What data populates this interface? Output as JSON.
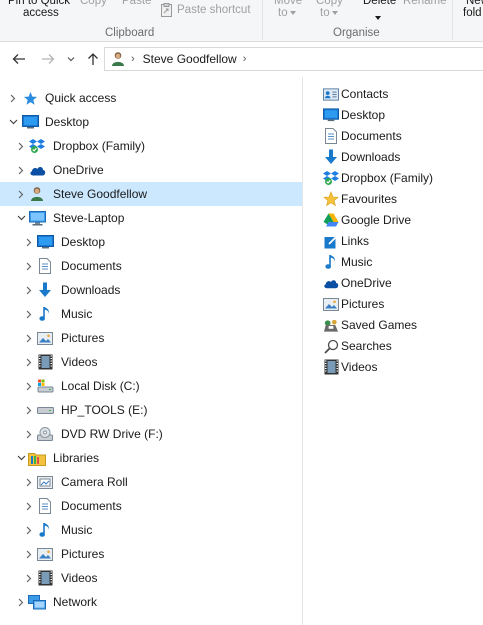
{
  "ribbon": {
    "pin_label_1": "Pin to Quick",
    "pin_label_2": "access",
    "copy_label": "Copy",
    "paste_label": "Paste",
    "paste_shortcut_label": "Paste shortcut",
    "clipboard_group": "Clipboard",
    "move_to_label_1": "Move",
    "move_to_label_2": "to",
    "copy_to_label_1": "Copy",
    "copy_to_label_2": "to",
    "delete_label": "Delete",
    "rename_label": "Rename",
    "organise_group": "Organise",
    "new_folder_label_1": "New",
    "new_folder_label_2": "fold"
  },
  "address": {
    "location": "Steve Goodfellow"
  },
  "tree": [
    {
      "label": "Quick access",
      "icon": "star-icon",
      "level": 0,
      "arrow": "right"
    },
    {
      "label": "Desktop",
      "icon": "desktop-icon",
      "level": 0,
      "arrow": "down"
    },
    {
      "label": "Dropbox (Family)",
      "icon": "dropbox-icon",
      "level": 1,
      "arrow": "right"
    },
    {
      "label": "OneDrive",
      "icon": "onedrive-icon",
      "level": 1,
      "arrow": "right"
    },
    {
      "label": "Steve Goodfellow",
      "icon": "user-icon",
      "level": 1,
      "arrow": "right",
      "selected": true
    },
    {
      "label": "Steve-Laptop",
      "icon": "computer-icon",
      "level": 1,
      "arrow": "down"
    },
    {
      "label": "Desktop",
      "icon": "desktop-icon",
      "level": 2,
      "arrow": "right"
    },
    {
      "label": "Documents",
      "icon": "documents-icon",
      "level": 2,
      "arrow": "right"
    },
    {
      "label": "Downloads",
      "icon": "downloads-icon",
      "level": 2,
      "arrow": "right"
    },
    {
      "label": "Music",
      "icon": "music-icon",
      "level": 2,
      "arrow": "right"
    },
    {
      "label": "Pictures",
      "icon": "pictures-icon",
      "level": 2,
      "arrow": "right"
    },
    {
      "label": "Videos",
      "icon": "videos-icon",
      "level": 2,
      "arrow": "right"
    },
    {
      "label": "Local Disk (C:)",
      "icon": "local-disk-icon",
      "level": 2,
      "arrow": "right"
    },
    {
      "label": "HP_TOOLS (E:)",
      "icon": "drive-icon",
      "level": 2,
      "arrow": "right"
    },
    {
      "label": "DVD RW Drive (F:)",
      "icon": "dvd-icon",
      "level": 2,
      "arrow": "right"
    },
    {
      "label": "Libraries",
      "icon": "libraries-icon",
      "level": 1,
      "arrow": "down"
    },
    {
      "label": "Camera Roll",
      "icon": "camera-roll-icon",
      "level": 2,
      "arrow": "right"
    },
    {
      "label": "Documents",
      "icon": "documents-icon",
      "level": 2,
      "arrow": "right"
    },
    {
      "label": "Music",
      "icon": "music-icon",
      "level": 2,
      "arrow": "right"
    },
    {
      "label": "Pictures",
      "icon": "pictures-icon",
      "level": 2,
      "arrow": "right"
    },
    {
      "label": "Videos",
      "icon": "videos-icon",
      "level": 2,
      "arrow": "right"
    },
    {
      "label": "Network",
      "icon": "network-icon",
      "level": 1,
      "arrow": "right"
    }
  ],
  "items": [
    {
      "label": "Contacts",
      "icon": "contacts-icon"
    },
    {
      "label": "Desktop",
      "icon": "desktop-icon"
    },
    {
      "label": "Documents",
      "icon": "documents-icon"
    },
    {
      "label": "Downloads",
      "icon": "downloads-icon"
    },
    {
      "label": "Dropbox (Family)",
      "icon": "dropbox-icon"
    },
    {
      "label": "Favourites",
      "icon": "favourites-icon"
    },
    {
      "label": "Google Drive",
      "icon": "google-drive-icon"
    },
    {
      "label": "Links",
      "icon": "links-icon"
    },
    {
      "label": "Music",
      "icon": "music-icon"
    },
    {
      "label": "OneDrive",
      "icon": "onedrive-icon"
    },
    {
      "label": "Pictures",
      "icon": "pictures-icon"
    },
    {
      "label": "Saved Games",
      "icon": "saved-games-icon"
    },
    {
      "label": "Searches",
      "icon": "searches-icon"
    },
    {
      "label": "Videos",
      "icon": "videos-icon"
    }
  ],
  "colors": {
    "selection": "#cce8ff",
    "accent_blue": "#1979ca"
  }
}
